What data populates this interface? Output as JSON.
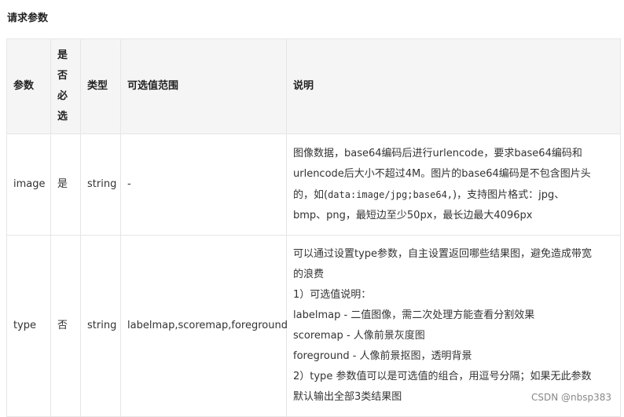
{
  "title": "请求参数",
  "headers": {
    "param": "参数",
    "required_chars": [
      "是",
      "否",
      "必",
      "选"
    ],
    "type": "类型",
    "range": "可选值范围",
    "desc": "说明"
  },
  "rows": [
    {
      "param": "image",
      "required": "是",
      "type": "string",
      "range": "-",
      "desc": {
        "line1": "图像数据，base64编码后进行urlencode，要求base64编码和",
        "line2": "urlencode后大小不超过4M。图片的base64编码是不包含图片头",
        "line3_pre": "的，如(",
        "line3_code": "data:image/jpg;base64,",
        "line3_post": ")，支持图片格式：jpg、",
        "line4": "bmp、png，最短边至少50px，最长边最大4096px"
      }
    },
    {
      "param": "type",
      "required": "否",
      "type": "string",
      "range": "labelmap,scoremap,foreground",
      "desc": {
        "line1": "可以通过设置type参数，自主设置返回哪些结果图，避免造成带宽",
        "line2": "的浪费",
        "line3": "1）可选值说明：",
        "line4": "labelmap - 二值图像，需二次处理方能查看分割效果",
        "line5": "scoremap - 人像前景灰度图",
        "line6": "foreground - 人像前景抠图，透明背景",
        "line7": "2）type 参数值可以是可选值的组合，用逗号分隔；如果无此参数",
        "line8": "默认输出全部3类结果图"
      }
    }
  ],
  "watermark": "CSDN @nbsp383"
}
